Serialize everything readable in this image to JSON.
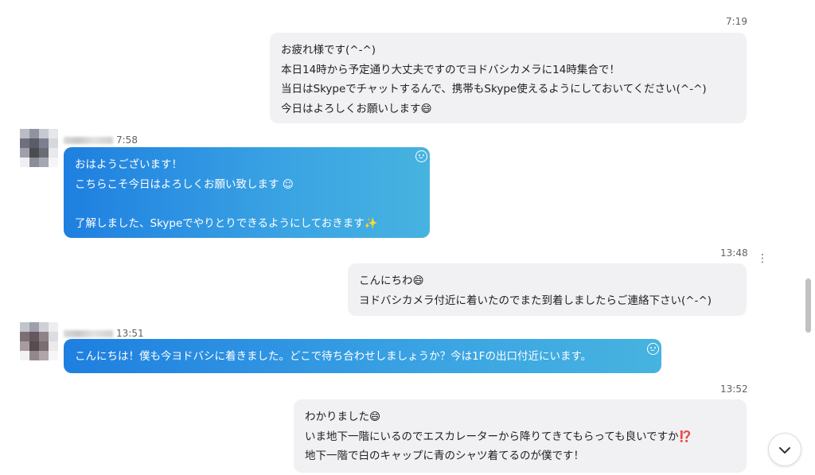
{
  "messages": [
    {
      "direction": "outgoing",
      "time": "7:19",
      "lines": [
        "お疲れ様です(^-^)",
        "本日14時から予定通り大丈夫ですのでヨドバシカメラに14時集合で！",
        "当日はSkypeでチャットするんで、携帯もSkype使えるようにしておいてください(^-^)",
        "今日はよろしくお願いします"
      ],
      "trailing_emoji": "😄"
    },
    {
      "direction": "incoming",
      "time": "7:58",
      "lines": [
        "おはようございます！",
        "こちらこそ今日はよろしくお願い致します",
        "",
        "了解しました、Skypeでやりとりできるようにしておきます"
      ],
      "line2_emoji": "☺",
      "trailing_emoji": "✨"
    },
    {
      "direction": "outgoing",
      "time": "13:48",
      "lines": [
        "こんにちわ",
        "ヨドバシカメラ付近に着いたのでまた到着しましたらご連絡下さい(^-^)"
      ],
      "line1_emoji": "😄"
    },
    {
      "direction": "incoming",
      "time": "13:51",
      "lines": [
        "こんにちは！僕も今ヨドバシに着きました。どこで待ち合わせしましょうか？今は1Fの出口付近にいます。"
      ]
    },
    {
      "direction": "outgoing",
      "time": "13:52",
      "lines": [
        "わかりました",
        "いま地下一階にいるのでエスカレーターから降りてきてもらっても良いですか",
        "地下一階で白のキャップに青のシャツ着てるのが僕です！"
      ],
      "line1_emoji": "😄",
      "line2_emoji": "⁉️"
    }
  ],
  "icons": {
    "reaction": "smiley-reaction-icon",
    "more": "more-options-icon",
    "scroll_down": "chevron-down-icon"
  },
  "colors": {
    "incoming_bubble_start": "#1e7fe0",
    "incoming_bubble_end": "#46b3e0",
    "outgoing_bubble": "#f1f1f4",
    "exclamation_question": "#e53935"
  }
}
